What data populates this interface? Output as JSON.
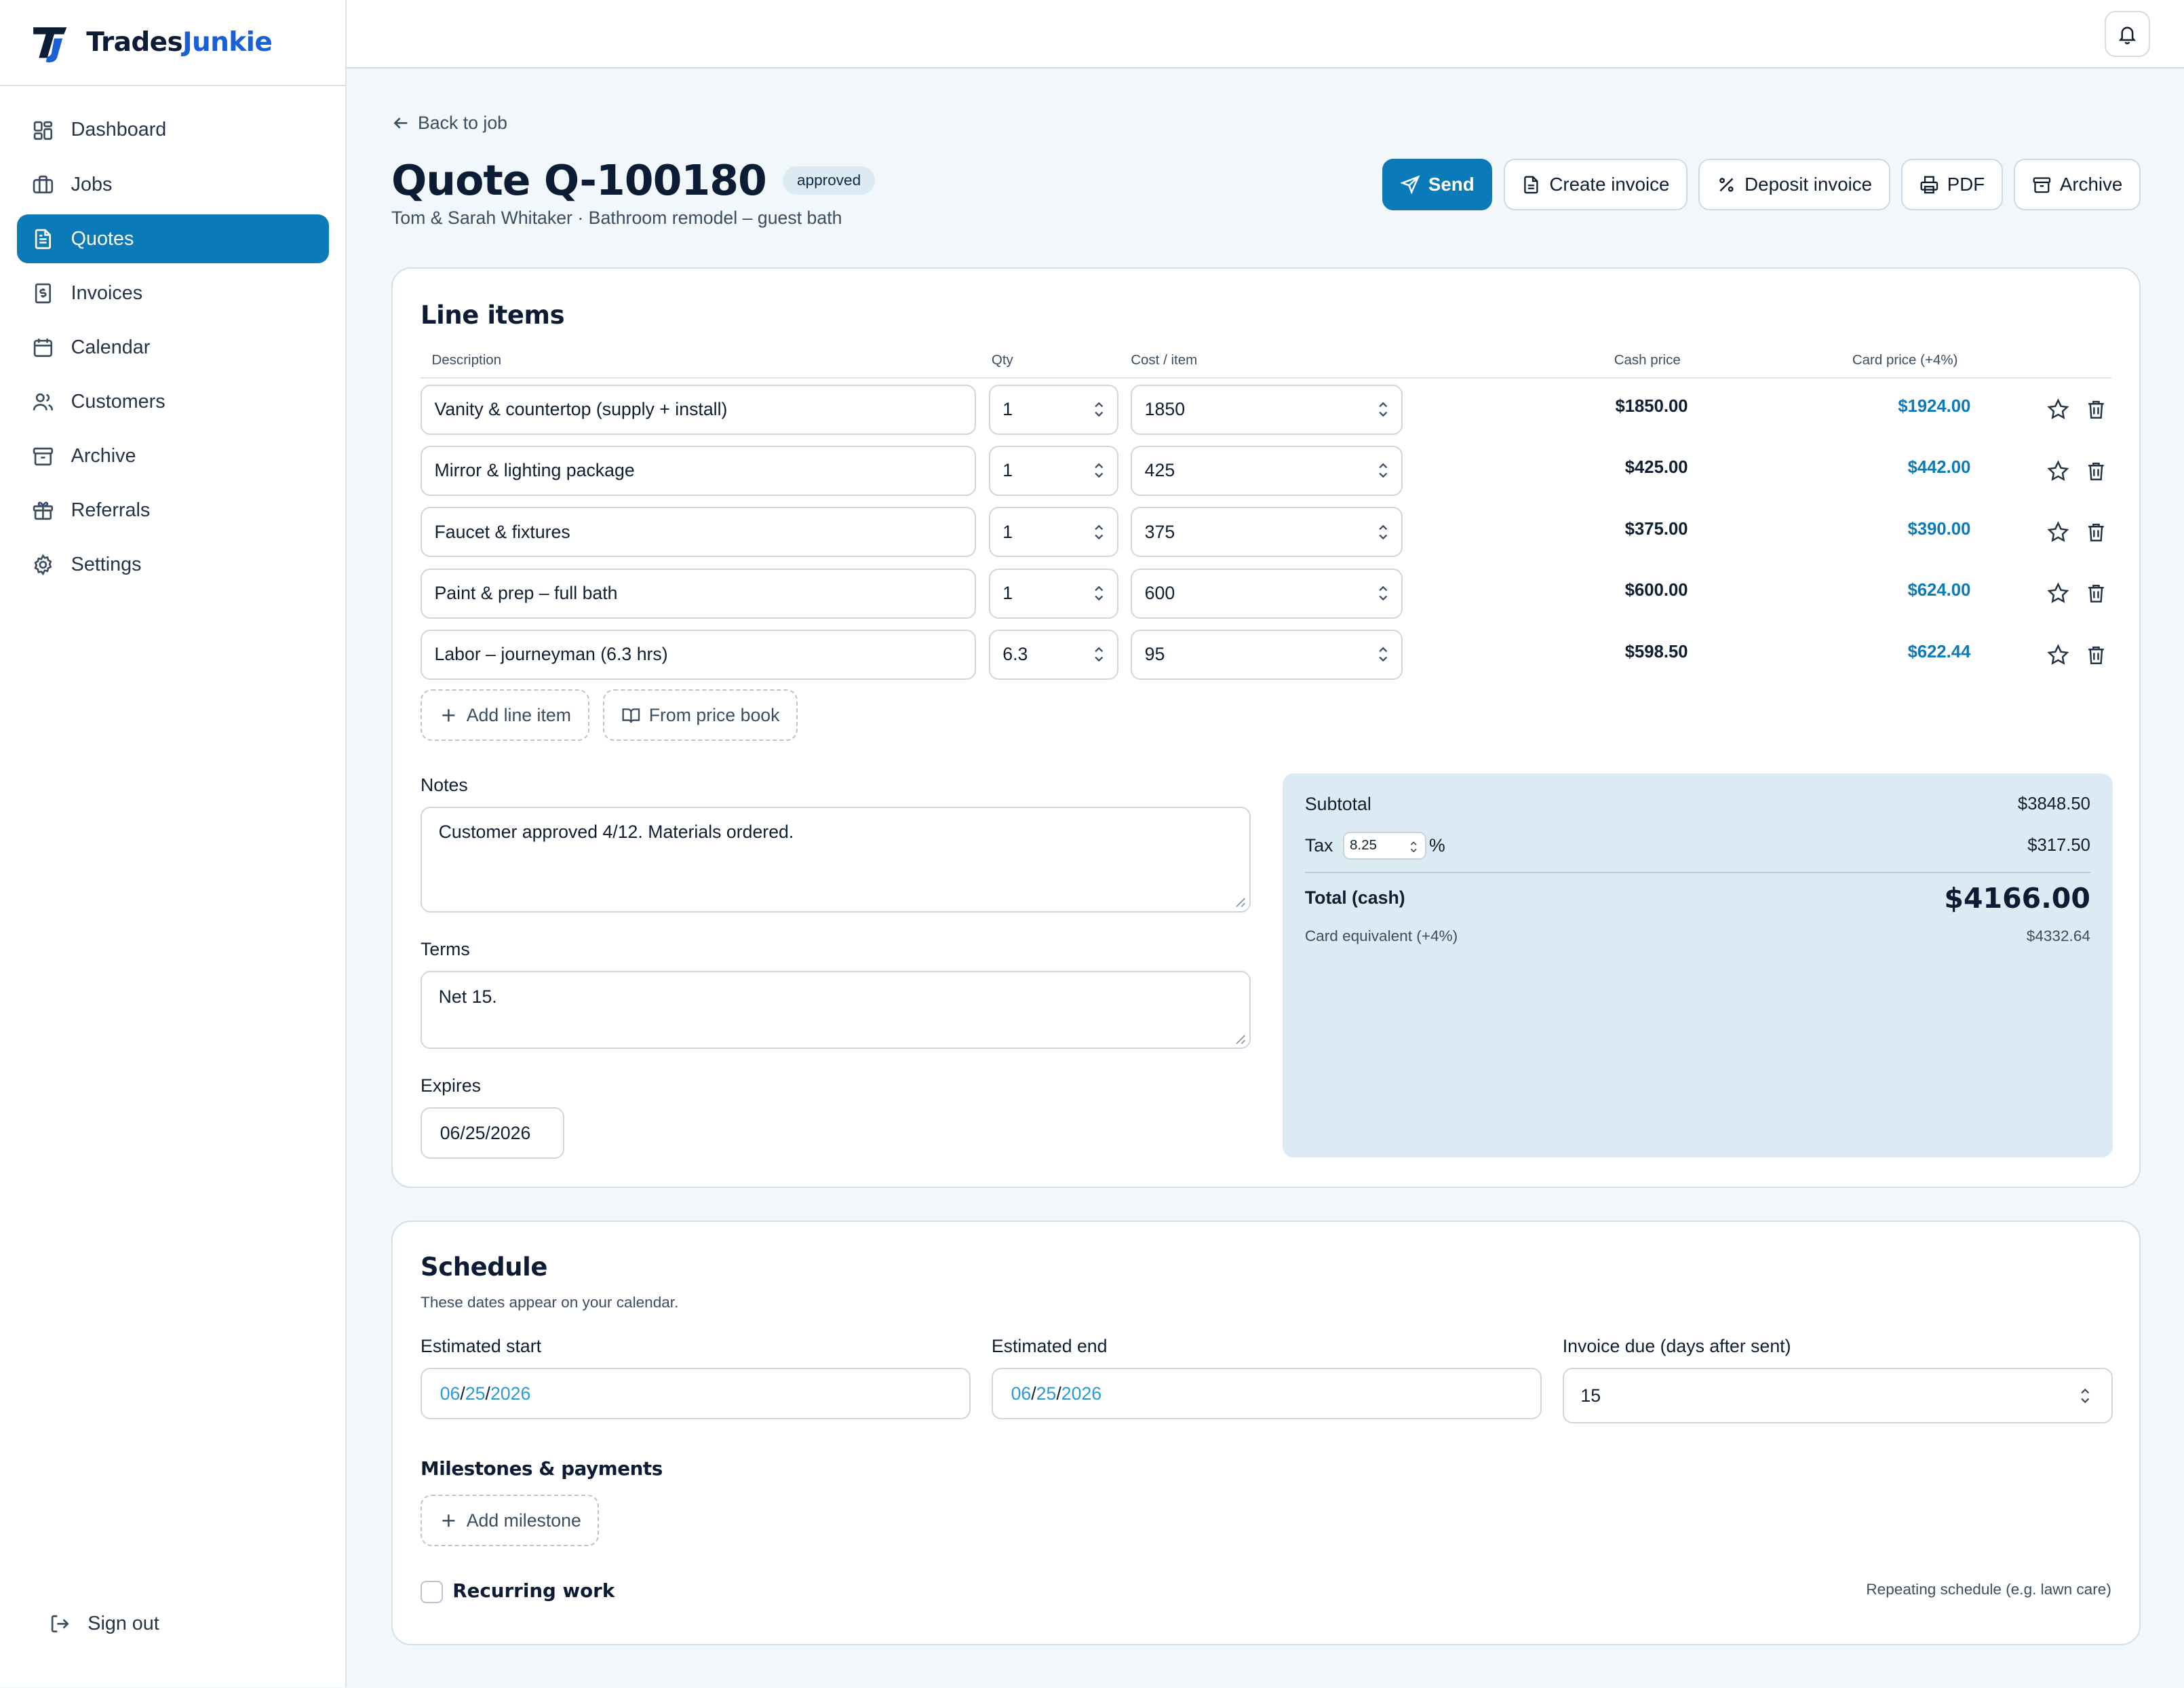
{
  "brand": {
    "name_part1": "Trades",
    "name_part2": "Junkie"
  },
  "nav": [
    {
      "label": "Dashboard",
      "icon": "grid-icon"
    },
    {
      "label": "Jobs",
      "icon": "briefcase-icon"
    },
    {
      "label": "Quotes",
      "icon": "file-text-icon",
      "active": true
    },
    {
      "label": "Invoices",
      "icon": "receipt-dollar-icon"
    },
    {
      "label": "Calendar",
      "icon": "calendar-icon"
    },
    {
      "label": "Customers",
      "icon": "users-icon"
    },
    {
      "label": "Archive",
      "icon": "archive-icon"
    },
    {
      "label": "Referrals",
      "icon": "gift-icon"
    },
    {
      "label": "Settings",
      "icon": "gear-icon"
    }
  ],
  "signout": "Sign out",
  "header": {
    "back": "Back to job",
    "title": "Quote Q-100180",
    "status": "approved",
    "subtitle": "Tom & Sarah Whitaker · Bathroom remodel – guest bath"
  },
  "actions": {
    "send": "Send",
    "create_invoice": "Create invoice",
    "deposit_invoice": "Deposit invoice",
    "pdf": "PDF",
    "archive": "Archive"
  },
  "line_items": {
    "title": "Line items",
    "columns": {
      "description": "Description",
      "qty": "Qty",
      "cost": "Cost / item",
      "cash": "Cash price",
      "card": "Card price (+4%)"
    },
    "rows": [
      {
        "description": "Vanity & countertop (supply + install)",
        "qty": "1",
        "cost": "1850",
        "cash": "$1850.00",
        "card": "$1924.00"
      },
      {
        "description": "Mirror & lighting package",
        "qty": "1",
        "cost": "425",
        "cash": "$425.00",
        "card": "$442.00"
      },
      {
        "description": "Faucet & fixtures",
        "qty": "1",
        "cost": "375",
        "cash": "$375.00",
        "card": "$390.00"
      },
      {
        "description": "Paint & prep – full bath",
        "qty": "1",
        "cost": "600",
        "cash": "$600.00",
        "card": "$624.00"
      },
      {
        "description": "Labor – journeyman (6.3 hrs)",
        "qty": "6.3",
        "cost": "95",
        "cash": "$598.50",
        "card": "$622.44"
      }
    ],
    "add_line": "Add line item",
    "from_price_book": "From price book"
  },
  "notes": {
    "label": "Notes",
    "value": "Customer approved 4/12. Materials ordered."
  },
  "terms": {
    "label": "Terms",
    "value": "Net 15."
  },
  "expires": {
    "label": "Expires",
    "month": "06",
    "day": "25",
    "year": "2026"
  },
  "summary": {
    "subtotal_label": "Subtotal",
    "subtotal": "$3848.50",
    "tax_label": "Tax",
    "tax_rate": "8.25",
    "tax_pct": "%",
    "tax": "$317.50",
    "total_label": "Total (cash)",
    "total": "$4166.00",
    "card_label": "Card equivalent (+4%)",
    "card_total": "$4332.64"
  },
  "schedule": {
    "title": "Schedule",
    "note": "These dates appear on your calendar.",
    "start_label": "Estimated start",
    "start": {
      "month": "06",
      "day": "25",
      "year": "2026"
    },
    "end_label": "Estimated end",
    "end": {
      "month": "06",
      "day": "25",
      "year": "2026"
    },
    "due_label": "Invoice due (days after sent)",
    "due": "15",
    "milestones_title": "Milestones & payments",
    "add_milestone": "Add milestone",
    "recurring": "Recurring work",
    "recurring_note": "Repeating schedule (e.g. lawn care)"
  },
  "colors": {
    "primary": "#0b7ab8",
    "card_price": "#0b7ab8",
    "summary_bg": "#dcebf3",
    "page_bg": "#f1f7fa"
  }
}
